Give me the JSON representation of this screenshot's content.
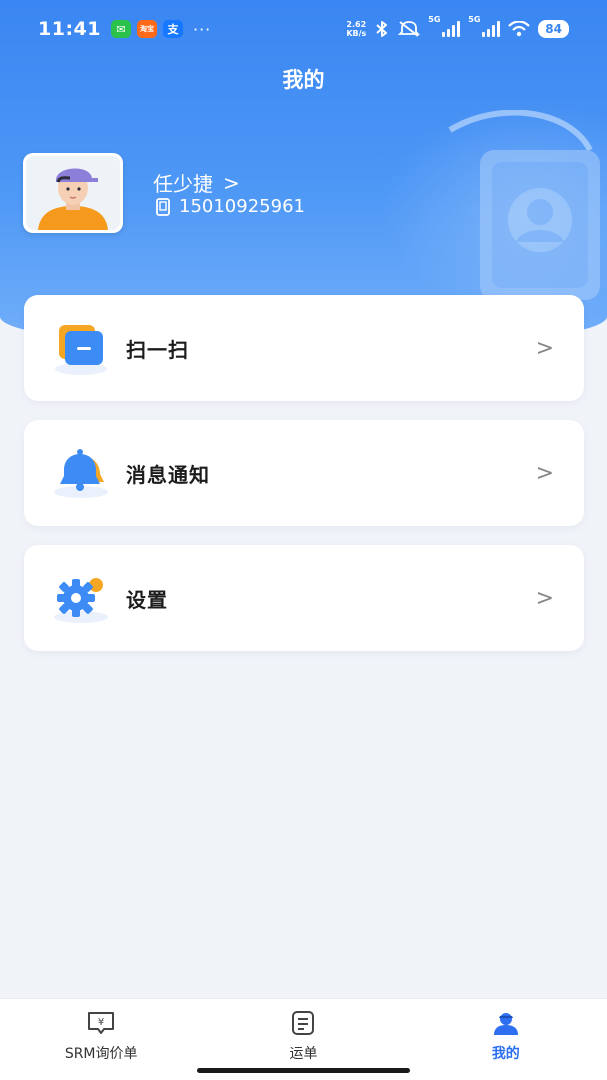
{
  "status_bar": {
    "time": "11:41",
    "apps": [
      {
        "name": "wechat-icon",
        "glyph": "✉"
      },
      {
        "name": "taobao-icon",
        "glyph": "淘宝"
      },
      {
        "name": "alipay-icon",
        "glyph": "支"
      }
    ],
    "more": "···",
    "net_speed_value": "2.62",
    "net_speed_unit": "KB/s",
    "sim1_label": "5G",
    "sim2_label": "5G",
    "battery": "84"
  },
  "header": {
    "title": "我的"
  },
  "profile": {
    "name": "任少捷",
    "name_chevron": ">",
    "phone": "15010925961"
  },
  "menu": {
    "items": [
      {
        "label": "扫一扫",
        "icon": "scan-icon",
        "chevron": ">"
      },
      {
        "label": "消息通知",
        "icon": "bell-icon",
        "chevron": ">"
      },
      {
        "label": "设置",
        "icon": "settings-gear-icon",
        "chevron": ">"
      }
    ]
  },
  "tabbar": {
    "tabs": [
      {
        "label": "SRM询价单",
        "icon": "inquiry-icon",
        "active": false
      },
      {
        "label": "运单",
        "icon": "waybill-icon",
        "active": false
      },
      {
        "label": "我的",
        "icon": "profile-icon",
        "active": true
      }
    ]
  },
  "colors": {
    "primary": "#2d6ff0",
    "header_gradient_top": "#3a86f2",
    "header_gradient_bottom": "#74b0fa",
    "background": "#f0f3f8"
  }
}
